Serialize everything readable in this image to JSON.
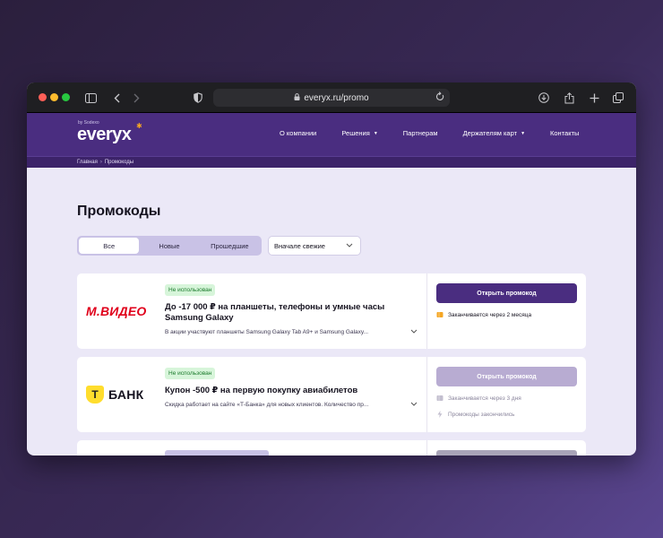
{
  "browser": {
    "url": "everyx.ru/promo"
  },
  "header": {
    "logo_by": "by Sodexo",
    "logo_word": "everyx",
    "nav": [
      {
        "label": "О компании",
        "dropdown": false
      },
      {
        "label": "Решения",
        "dropdown": true
      },
      {
        "label": "Партнерам",
        "dropdown": false
      },
      {
        "label": "Держателям карт",
        "dropdown": true
      },
      {
        "label": "Контакты",
        "dropdown": false
      }
    ]
  },
  "breadcrumbs": {
    "home": "Главная",
    "separator": "›",
    "current": "Промокоды"
  },
  "page": {
    "title": "Промокоды",
    "filters": [
      "Все",
      "Новые",
      "Прошедшие"
    ],
    "active_filter": "Все",
    "sort_value": "Вначале свежие"
  },
  "promos": [
    {
      "brand": "М.ВИДЕО",
      "brand_color": "#e0001b",
      "status": "Не использован",
      "title": "До -17 000 ₽ на планшеты, телефоны и умные часы Samsung Galaxy",
      "description": "В акции участвуют планшеты Samsung Galaxy Tab A9+ и Samsung Galaxy...",
      "button": "Открыть промокод",
      "button_enabled": true,
      "expires": "Заканчивается через 2 месяца",
      "extra": ""
    },
    {
      "brand": "БАНК",
      "brand_mark": "Т",
      "brand_color": "#ffdd2d",
      "status": "Не использован",
      "title": "Купон -500 ₽ на первую покупку авиабилетов",
      "description": "Скидка работает на сайте «Т-Банка» для новых клиентов. Количество пр...",
      "button": "Открыть промокод",
      "button_enabled": false,
      "expires": "Заканчивается через 3 дня",
      "extra": "Промокоды закончились"
    }
  ],
  "colors": {
    "primary": "#4a2d80",
    "page_bg": "#ebe8f7",
    "badge_bg": "#d7f5da",
    "badge_text": "#1b7a2c",
    "expires_icon": "#f5a623"
  }
}
